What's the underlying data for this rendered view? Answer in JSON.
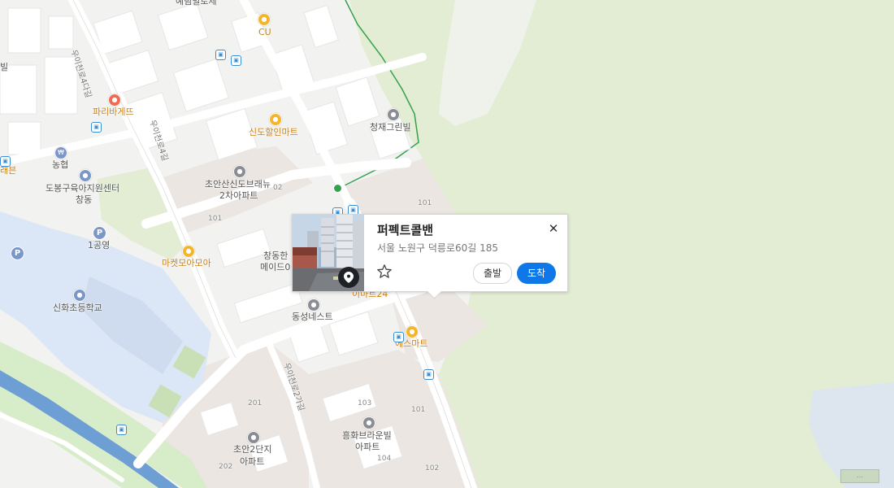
{
  "place_card": {
    "title": "퍼펙트콜밴",
    "address": "서울 노원구 덕릉로60길 185",
    "departure_label": "출발",
    "arrival_label": "도착",
    "close_icon": "close-icon",
    "favorite_icon": "star-outline-icon",
    "marker_icon": "location-pin-icon"
  },
  "colors": {
    "park": "#e2edd3",
    "block": "#ffffff",
    "land": "#f2f2f0",
    "apartment_area": "#ebe6e1",
    "school": "#dbe7f6",
    "river": "#6d9fd5",
    "accent_button": "#0f78e8",
    "park_trail": "#35a04e"
  },
  "labels": {
    "yerim": "예림빌로제",
    "cu": "CU",
    "paris": "파리바게뜨",
    "sindo_mart": "신도할인마트",
    "cheongjae": "청재그린빌",
    "nonghyup": "농협",
    "dobong_center": "도봉구육아지원센터",
    "dobong_center_2": "창동",
    "choan_sindo": "초안산신도브래뉴",
    "choan_sindo_2": "2차아파트",
    "gongyeong": "1공영",
    "market_moa": "마켓모아모아",
    "changdong_han": "창동한",
    "changdong_han_2": "메이드0",
    "sinhwa_school": "신화초등학교",
    "dongseong": "동성네스트",
    "emart24": "이마트24",
    "s_mart": "에스마트",
    "heunghwa": "흥화브라운빌",
    "heunghwa_2": "아파트",
    "choan_2": "초안2단지",
    "choan_2_2": "아파트",
    "edge_left_1": "빌",
    "edge_left_2": "래븐"
  },
  "roads": {
    "r1": "우이천로4다길",
    "r2": "우이천로4길",
    "r3": "우이천로2가길"
  },
  "bldg_numbers": {
    "n101a": "101",
    "n101b": "101",
    "n102": "02",
    "n201": "201",
    "n202": "202",
    "n103": "103",
    "n101c": "101",
    "n104": "104",
    "n102b": "102"
  },
  "scale_text": "..."
}
